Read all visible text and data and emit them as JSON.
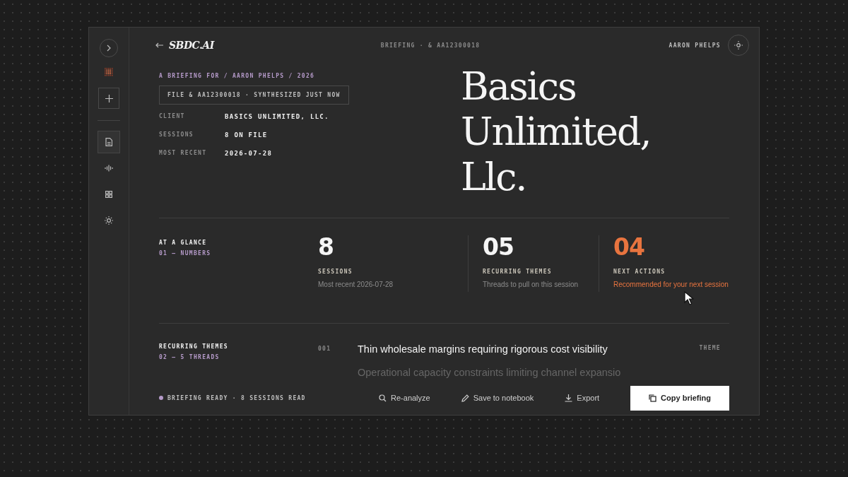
{
  "sidebar": {
    "nav": [
      {
        "selected": true
      },
      {
        "selected": false
      },
      {
        "selected": false
      },
      {
        "selected": false
      }
    ]
  },
  "header": {
    "logo": "SBDC.AI",
    "crumb": "BRIEFING · & AA12300018",
    "user": "AARON PHELPS"
  },
  "hero": {
    "eyebrow": "A BRIEFING FOR / AARON PHELPS / 2026",
    "file_tag": "FILE & AA12300018 · SYNTHESIZED JUST NOW",
    "meta": [
      {
        "label": "CLIENT",
        "value": "BASICS UNLIMITED, LLC."
      },
      {
        "label": "SESSIONS",
        "value": "8 ON FILE"
      },
      {
        "label": "MOST RECENT",
        "value": "2026-07-28"
      }
    ],
    "title": "Basics Unlimited, Llc."
  },
  "glance": {
    "title": "AT A GLANCE",
    "subtitle": "01 — NUMBERS",
    "stats": [
      {
        "number": "8",
        "label": "SESSIONS",
        "note": "Most recent 2026-07-28",
        "accent": false
      },
      {
        "number": "05",
        "label": "RECURRING THEMES",
        "note": "Threads to pull on this session",
        "accent": false
      },
      {
        "number": "04",
        "label": "NEXT ACTIONS",
        "note": "Recommended for your next session",
        "accent": true
      }
    ]
  },
  "themes": {
    "title": "RECURRING THEMES",
    "subtitle": "02 — 5 THREADS",
    "rows": [
      {
        "number": "001",
        "text": "Thin wholesale margins requiring rigorous cost visibility",
        "tag": "THEME"
      },
      {
        "text": "Operational capacity constraints limiting channel expansio"
      }
    ]
  },
  "status_bar": {
    "status": "BRIEFING READY · 8 SESSIONS READ",
    "color": "#b59ac9",
    "buttons": [
      {
        "label": "Re-analyze",
        "kind": "ghost"
      },
      {
        "label": "Save to notebook",
        "kind": "ghost"
      },
      {
        "label": "Export",
        "kind": "ghost"
      },
      {
        "label": "Copy briefing",
        "kind": "primary"
      }
    ]
  }
}
